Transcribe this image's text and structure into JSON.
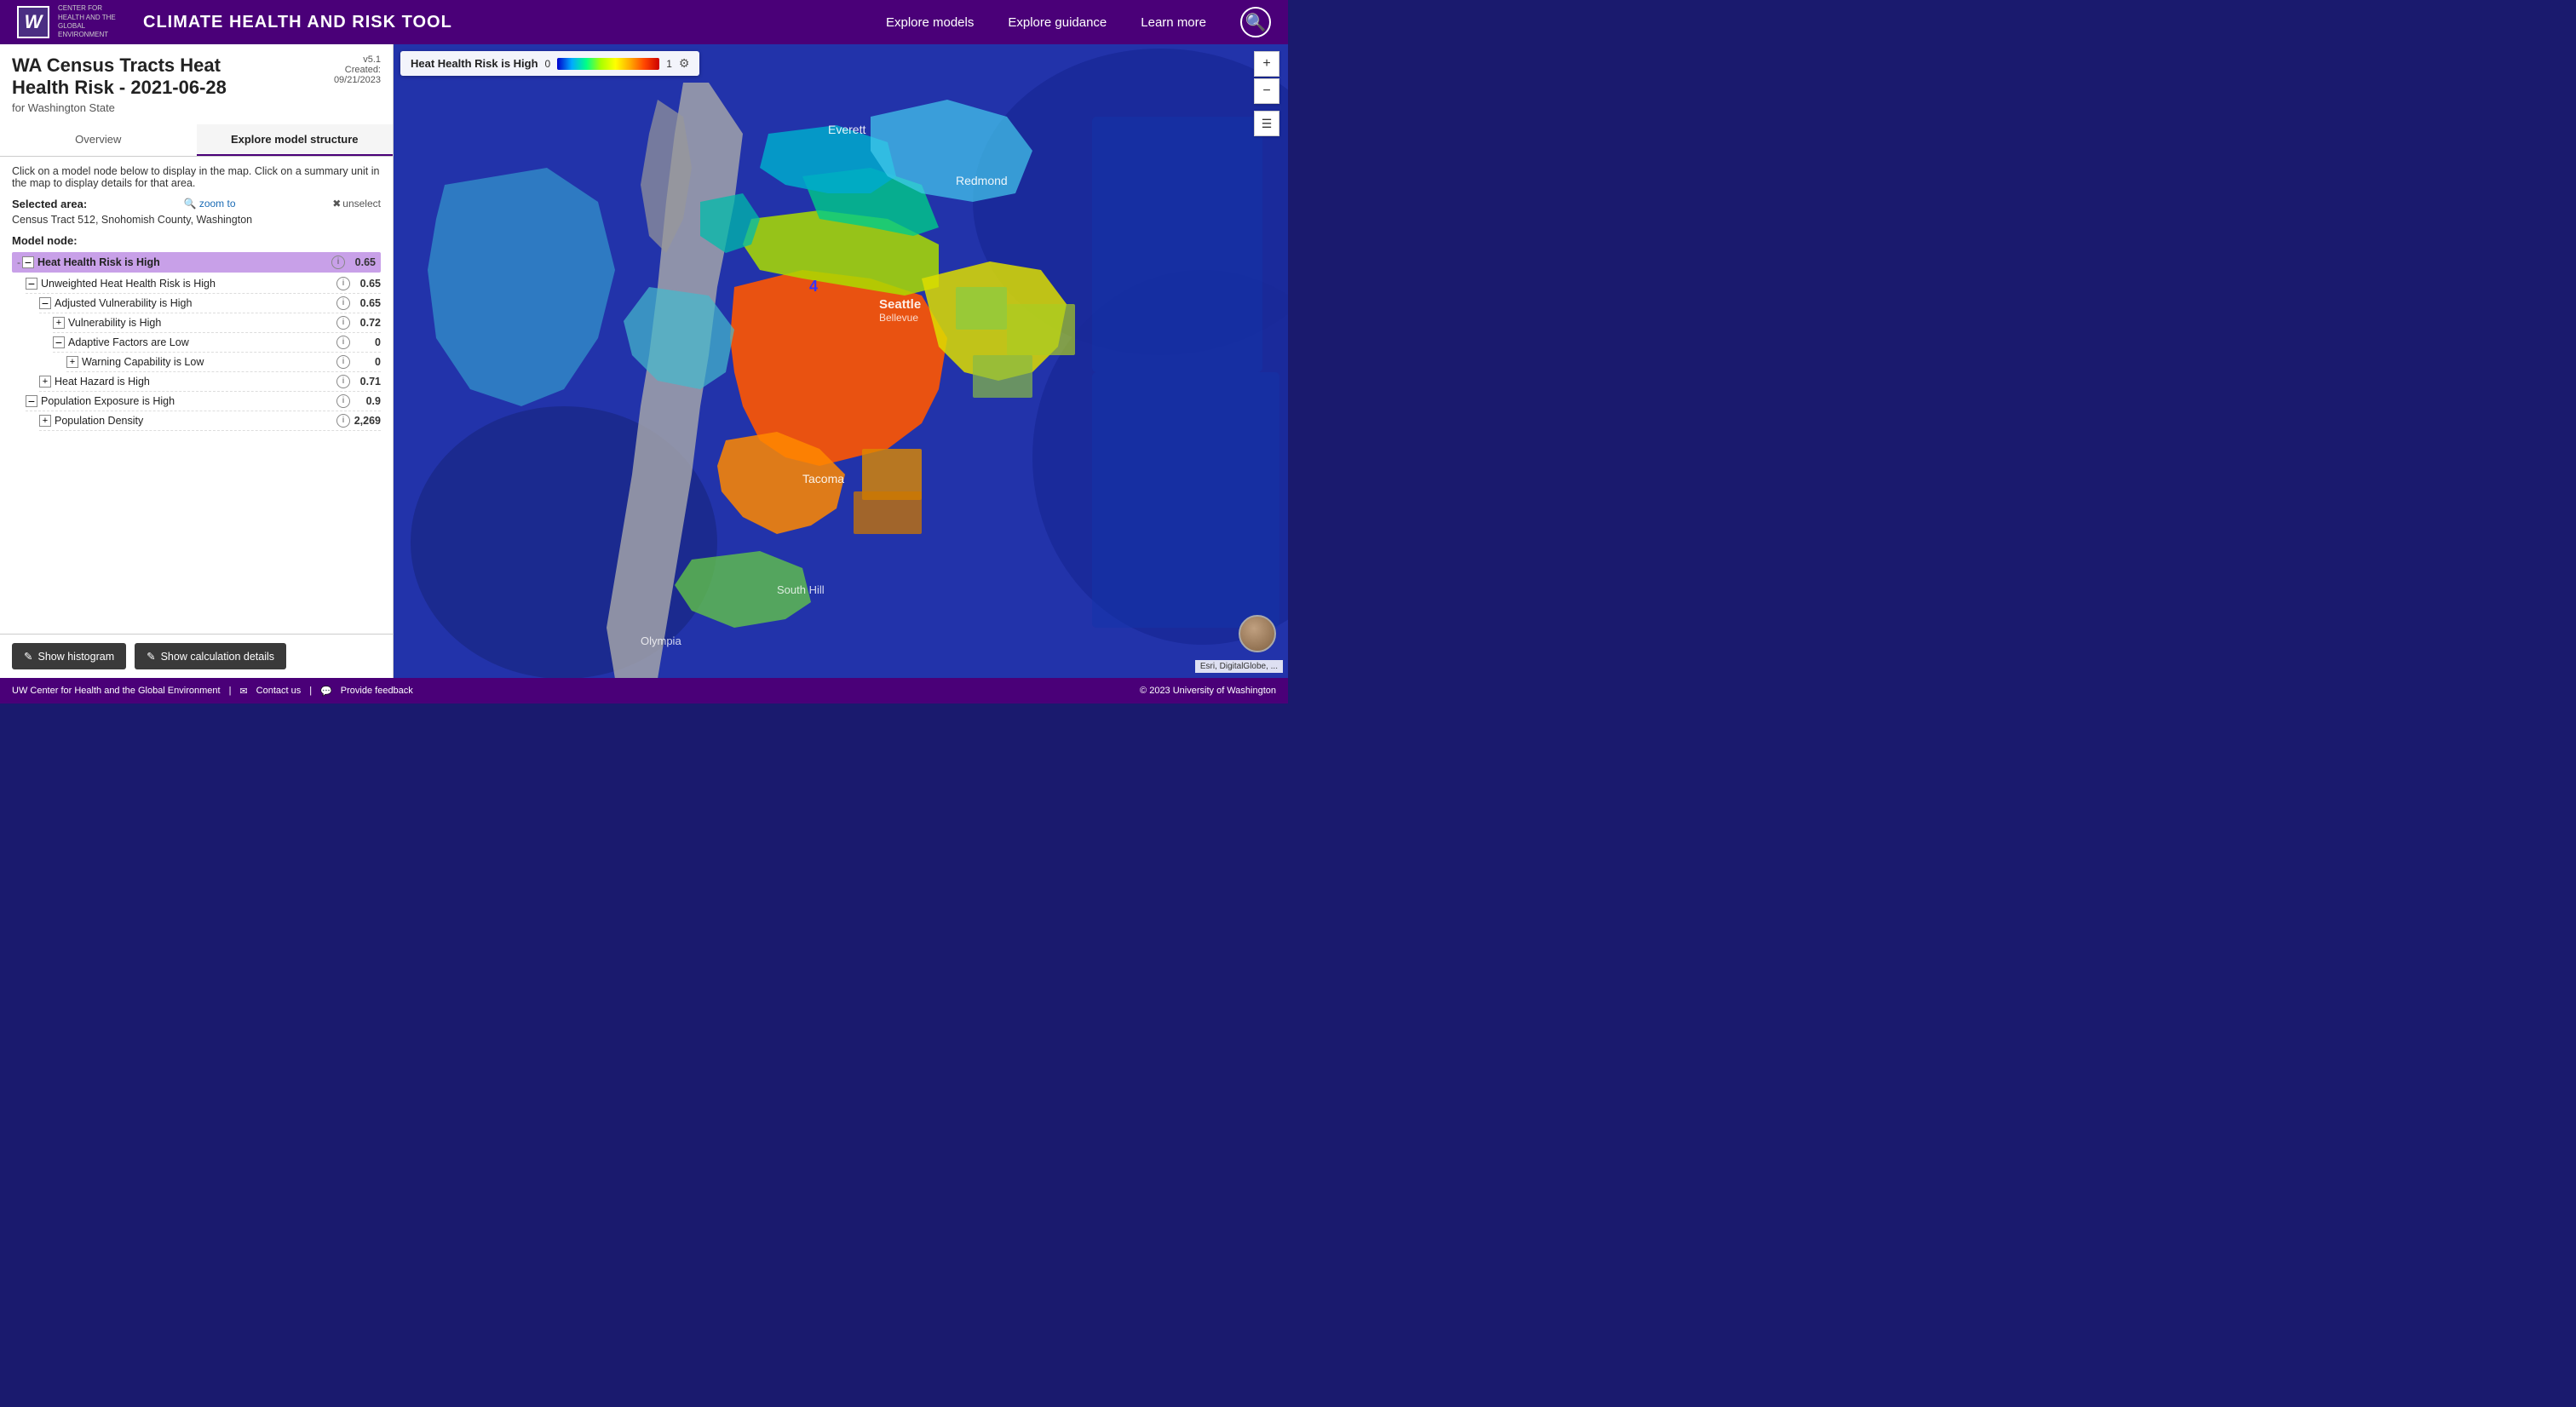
{
  "header": {
    "logo_w": "W",
    "logo_center": "CENTER FOR HEALTH\nAND THE GLOBAL\nENVIRONMENT",
    "title": "Climate Health and Risk Tool",
    "nav": {
      "explore_models": "Explore models",
      "explore_guidance": "Explore guidance",
      "learn_more": "Learn more"
    }
  },
  "sidebar": {
    "title": "WA Census Tracts Heat\nHealth Risk - 2021-06-28",
    "version": "v5.1",
    "created": "Created:\n09/21/2023",
    "subtitle": "for Washington State",
    "tabs": [
      {
        "label": "Overview",
        "active": false
      },
      {
        "label": "Explore model structure",
        "active": true
      }
    ],
    "instruction": "Click on a model node below to display in the map. Click on a summary unit in the map to display details for that area.",
    "selected_area_label": "Selected area:",
    "zoom_to": "zoom to",
    "unselect": "unselect",
    "selected_area_name": "Census Tract 512, Snohomish County, Washington",
    "model_node_label": "Model node:",
    "tree": [
      {
        "indent": 0,
        "type": "minus",
        "label": "Heat Health Risk is High",
        "info": true,
        "value": "0.65",
        "root": true
      },
      {
        "indent": 1,
        "type": "minus",
        "label": "Unweighted Heat Health Risk is High",
        "info": true,
        "value": "0.65"
      },
      {
        "indent": 2,
        "type": "minus",
        "label": "Adjusted Vulnerability is High",
        "info": true,
        "value": "0.65"
      },
      {
        "indent": 3,
        "type": "plus",
        "label": "Vulnerability is High",
        "info": true,
        "value": "0.72"
      },
      {
        "indent": 3,
        "type": "minus",
        "label": "Adaptive Factors are Low",
        "info": true,
        "value": "0"
      },
      {
        "indent": 4,
        "type": "plus",
        "label": "Warning Capability is Low",
        "info": true,
        "value": "0"
      },
      {
        "indent": 2,
        "type": "plus",
        "label": "Heat Hazard is High",
        "info": true,
        "value": "0.71"
      },
      {
        "indent": 1,
        "type": "minus",
        "label": "Population Exposure is High",
        "info": true,
        "value": "0.9"
      },
      {
        "indent": 2,
        "type": "plus",
        "label": "Population Density",
        "info": true,
        "value": "2,269"
      }
    ],
    "buttons": {
      "histogram": "Show histogram",
      "calculation": "Show calculation details"
    }
  },
  "legend": {
    "title": "Heat Health Risk is High",
    "min": "0",
    "max": "1"
  },
  "map": {
    "marker": "4",
    "esri_credit": "Esri, DigitalGlobe, ..."
  },
  "footer": {
    "center": "UW Center for Health and the Global Environment",
    "contact": "Contact us",
    "feedback": "Provide feedback",
    "copyright": "© 2023 University of Washington"
  }
}
